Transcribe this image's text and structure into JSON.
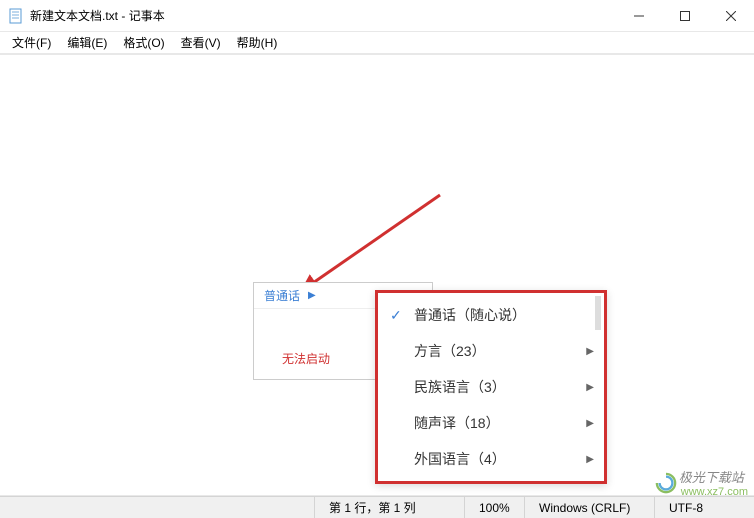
{
  "titlebar": {
    "filename": "新建文本文档.txt",
    "appname": "记事本",
    "separator": " - "
  },
  "menubar": {
    "items": [
      {
        "label": "文件(F)"
      },
      {
        "label": "编辑(E)"
      },
      {
        "label": "格式(O)"
      },
      {
        "label": "查看(V)"
      },
      {
        "label": "帮助(H)"
      }
    ]
  },
  "ime": {
    "language": "普通话",
    "error": "无法启动"
  },
  "dropdown": {
    "items": [
      {
        "label": "普通话（随心说）",
        "checked": true,
        "submenu": false
      },
      {
        "label": "方言（23）",
        "checked": false,
        "submenu": true
      },
      {
        "label": "民族语言（3）",
        "checked": false,
        "submenu": true
      },
      {
        "label": "随声译（18）",
        "checked": false,
        "submenu": true
      },
      {
        "label": "外国语言（4）",
        "checked": false,
        "submenu": true
      }
    ]
  },
  "statusbar": {
    "position": "第 1 行，第 1 列",
    "zoom": "100%",
    "lineending": "Windows (CRLF)",
    "encoding": "UTF-8"
  },
  "watermark": {
    "text": "极光下载站",
    "url": "www.xz7.com"
  },
  "colors": {
    "accent": "#3b7fd4",
    "highlight": "#d03030"
  }
}
